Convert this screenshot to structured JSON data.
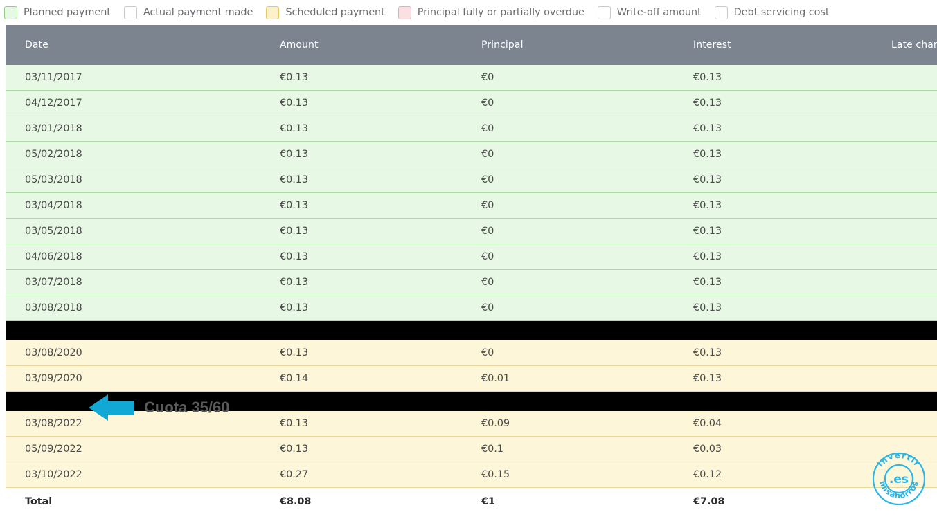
{
  "legend": {
    "items": [
      {
        "label": "Planned payment",
        "color": "#e7f8e4",
        "border": "#8fd07f"
      },
      {
        "label": "Actual payment made",
        "color": "#ffffff",
        "border": "#c9c9c9"
      },
      {
        "label": "Scheduled payment",
        "color": "#fdf1cb",
        "border": "#e8c95f"
      },
      {
        "label": "Principal fully or partially overdue",
        "color": "#fbe0e3",
        "border": "#f0a9b2"
      },
      {
        "label": "Write-off amount",
        "color": "#ffffff",
        "border": "#c9c9c9"
      },
      {
        "label": "Debt servicing cost",
        "color": "#ffffff",
        "border": "#c9c9c9"
      }
    ]
  },
  "table": {
    "headers": [
      "Date",
      "Amount",
      "Principal",
      "Interest",
      "Late charge"
    ],
    "header_bg": "#7c8490",
    "rows": [
      {
        "type": "planned",
        "cells": [
          "03/11/2017",
          "€0.13",
          "€0",
          "€0.13",
          ""
        ]
      },
      {
        "type": "planned",
        "cells": [
          "04/12/2017",
          "€0.13",
          "€0",
          "€0.13",
          ""
        ]
      },
      {
        "type": "planned",
        "cells": [
          "03/01/2018",
          "€0.13",
          "€0",
          "€0.13",
          ""
        ]
      },
      {
        "type": "planned",
        "cells": [
          "05/02/2018",
          "€0.13",
          "€0",
          "€0.13",
          ""
        ]
      },
      {
        "type": "planned",
        "cells": [
          "05/03/2018",
          "€0.13",
          "€0",
          "€0.13",
          ""
        ]
      },
      {
        "type": "planned",
        "cells": [
          "03/04/2018",
          "€0.13",
          "€0",
          "€0.13",
          ""
        ]
      },
      {
        "type": "planned",
        "cells": [
          "03/05/2018",
          "€0.13",
          "€0",
          "€0.13",
          ""
        ]
      },
      {
        "type": "planned",
        "cells": [
          "04/06/2018",
          "€0.13",
          "€0",
          "€0.13",
          ""
        ]
      },
      {
        "type": "planned",
        "cells": [
          "03/07/2018",
          "€0.13",
          "€0",
          "€0.13",
          ""
        ]
      },
      {
        "type": "planned",
        "cells": [
          "03/08/2018",
          "€0.13",
          "€0",
          "€0.13",
          ""
        ]
      },
      {
        "type": "redacted",
        "cells": [
          "",
          "",
          "",
          "",
          ""
        ]
      },
      {
        "type": "scheduled",
        "cells": [
          "03/08/2020",
          "€0.13",
          "€0",
          "€0.13",
          ""
        ]
      },
      {
        "type": "scheduled",
        "cells": [
          "03/09/2020",
          "€0.14",
          "€0.01",
          "€0.13",
          ""
        ]
      },
      {
        "type": "redacted",
        "cells": [
          "",
          "",
          "",
          "",
          ""
        ]
      },
      {
        "type": "scheduled",
        "cells": [
          "03/08/2022",
          "€0.13",
          "€0.09",
          "€0.04",
          ""
        ]
      },
      {
        "type": "scheduled",
        "cells": [
          "05/09/2022",
          "€0.13",
          "€0.1",
          "€0.03",
          ""
        ]
      },
      {
        "type": "scheduled",
        "cells": [
          "03/10/2022",
          "€0.27",
          "€0.15",
          "€0.12",
          ""
        ]
      },
      {
        "type": "total",
        "cells": [
          "Total",
          "€8.08",
          "€1",
          "€7.08",
          ""
        ]
      }
    ]
  },
  "annotation": {
    "text": "Cuota 35/60",
    "arrow_color": "#12a8d6",
    "text_color": "#5a5a5a"
  },
  "watermark": {
    "top_text": "invertir",
    "bottom_text": "misahorros",
    "center_text": ".es",
    "color": "#29b6e8"
  }
}
